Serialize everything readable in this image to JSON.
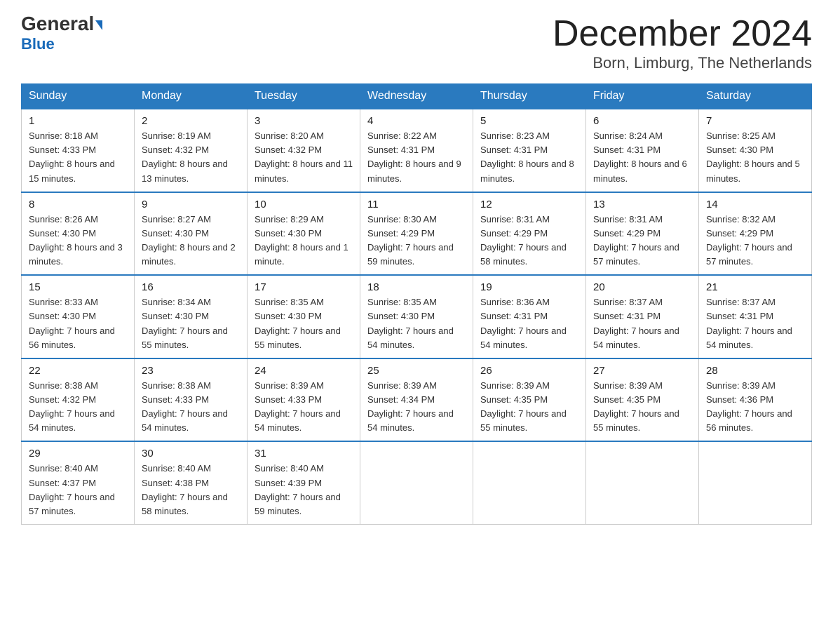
{
  "header": {
    "logo_general": "General",
    "logo_blue": "Blue",
    "month_title": "December 2024",
    "location": "Born, Limburg, The Netherlands"
  },
  "days_of_week": [
    "Sunday",
    "Monday",
    "Tuesday",
    "Wednesday",
    "Thursday",
    "Friday",
    "Saturday"
  ],
  "weeks": [
    [
      {
        "day": "1",
        "sunrise": "8:18 AM",
        "sunset": "4:33 PM",
        "daylight": "8 hours and 15 minutes."
      },
      {
        "day": "2",
        "sunrise": "8:19 AM",
        "sunset": "4:32 PM",
        "daylight": "8 hours and 13 minutes."
      },
      {
        "day": "3",
        "sunrise": "8:20 AM",
        "sunset": "4:32 PM",
        "daylight": "8 hours and 11 minutes."
      },
      {
        "day": "4",
        "sunrise": "8:22 AM",
        "sunset": "4:31 PM",
        "daylight": "8 hours and 9 minutes."
      },
      {
        "day": "5",
        "sunrise": "8:23 AM",
        "sunset": "4:31 PM",
        "daylight": "8 hours and 8 minutes."
      },
      {
        "day": "6",
        "sunrise": "8:24 AM",
        "sunset": "4:31 PM",
        "daylight": "8 hours and 6 minutes."
      },
      {
        "day": "7",
        "sunrise": "8:25 AM",
        "sunset": "4:30 PM",
        "daylight": "8 hours and 5 minutes."
      }
    ],
    [
      {
        "day": "8",
        "sunrise": "8:26 AM",
        "sunset": "4:30 PM",
        "daylight": "8 hours and 3 minutes."
      },
      {
        "day": "9",
        "sunrise": "8:27 AM",
        "sunset": "4:30 PM",
        "daylight": "8 hours and 2 minutes."
      },
      {
        "day": "10",
        "sunrise": "8:29 AM",
        "sunset": "4:30 PM",
        "daylight": "8 hours and 1 minute."
      },
      {
        "day": "11",
        "sunrise": "8:30 AM",
        "sunset": "4:29 PM",
        "daylight": "7 hours and 59 minutes."
      },
      {
        "day": "12",
        "sunrise": "8:31 AM",
        "sunset": "4:29 PM",
        "daylight": "7 hours and 58 minutes."
      },
      {
        "day": "13",
        "sunrise": "8:31 AM",
        "sunset": "4:29 PM",
        "daylight": "7 hours and 57 minutes."
      },
      {
        "day": "14",
        "sunrise": "8:32 AM",
        "sunset": "4:29 PM",
        "daylight": "7 hours and 57 minutes."
      }
    ],
    [
      {
        "day": "15",
        "sunrise": "8:33 AM",
        "sunset": "4:30 PM",
        "daylight": "7 hours and 56 minutes."
      },
      {
        "day": "16",
        "sunrise": "8:34 AM",
        "sunset": "4:30 PM",
        "daylight": "7 hours and 55 minutes."
      },
      {
        "day": "17",
        "sunrise": "8:35 AM",
        "sunset": "4:30 PM",
        "daylight": "7 hours and 55 minutes."
      },
      {
        "day": "18",
        "sunrise": "8:35 AM",
        "sunset": "4:30 PM",
        "daylight": "7 hours and 54 minutes."
      },
      {
        "day": "19",
        "sunrise": "8:36 AM",
        "sunset": "4:31 PM",
        "daylight": "7 hours and 54 minutes."
      },
      {
        "day": "20",
        "sunrise": "8:37 AM",
        "sunset": "4:31 PM",
        "daylight": "7 hours and 54 minutes."
      },
      {
        "day": "21",
        "sunrise": "8:37 AM",
        "sunset": "4:31 PM",
        "daylight": "7 hours and 54 minutes."
      }
    ],
    [
      {
        "day": "22",
        "sunrise": "8:38 AM",
        "sunset": "4:32 PM",
        "daylight": "7 hours and 54 minutes."
      },
      {
        "day": "23",
        "sunrise": "8:38 AM",
        "sunset": "4:33 PM",
        "daylight": "7 hours and 54 minutes."
      },
      {
        "day": "24",
        "sunrise": "8:39 AM",
        "sunset": "4:33 PM",
        "daylight": "7 hours and 54 minutes."
      },
      {
        "day": "25",
        "sunrise": "8:39 AM",
        "sunset": "4:34 PM",
        "daylight": "7 hours and 54 minutes."
      },
      {
        "day": "26",
        "sunrise": "8:39 AM",
        "sunset": "4:35 PM",
        "daylight": "7 hours and 55 minutes."
      },
      {
        "day": "27",
        "sunrise": "8:39 AM",
        "sunset": "4:35 PM",
        "daylight": "7 hours and 55 minutes."
      },
      {
        "day": "28",
        "sunrise": "8:39 AM",
        "sunset": "4:36 PM",
        "daylight": "7 hours and 56 minutes."
      }
    ],
    [
      {
        "day": "29",
        "sunrise": "8:40 AM",
        "sunset": "4:37 PM",
        "daylight": "7 hours and 57 minutes."
      },
      {
        "day": "30",
        "sunrise": "8:40 AM",
        "sunset": "4:38 PM",
        "daylight": "7 hours and 58 minutes."
      },
      {
        "day": "31",
        "sunrise": "8:40 AM",
        "sunset": "4:39 PM",
        "daylight": "7 hours and 59 minutes."
      },
      null,
      null,
      null,
      null
    ]
  ]
}
